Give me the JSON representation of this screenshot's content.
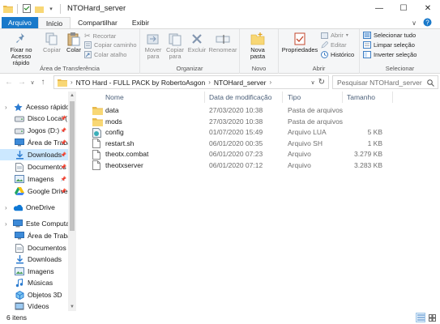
{
  "window": {
    "title": "NTOHard_server",
    "controls": {
      "minimize": "—",
      "maximize": "☐",
      "close": "✕"
    }
  },
  "ribbon_tabs": [
    {
      "label": "Arquivo"
    },
    {
      "label": "Início"
    },
    {
      "label": "Compartilhar"
    },
    {
      "label": "Exibir"
    }
  ],
  "ribbon": {
    "clipboard": {
      "pin": "Fixar no Acesso rápido",
      "copy": "Copiar",
      "paste": "Colar",
      "cut": "Recortar",
      "copy_path": "Copiar caminho",
      "paste_shortcut": "Colar atalho",
      "label": "Área de Transferência"
    },
    "organize": {
      "move_to": "Mover para",
      "copy_to": "Copiar para",
      "delete": "Excluir",
      "rename": "Renomear",
      "label": "Organizar"
    },
    "new": {
      "new_folder": "Nova pasta",
      "label": "Novo"
    },
    "open": {
      "properties": "Propriedades",
      "open": "Abrir",
      "edit": "Editar",
      "history": "Histórico",
      "label": "Abrir"
    },
    "select": {
      "select_all": "Selecionar tudo",
      "select_none": "Limpar seleção",
      "invert": "Inverter seleção",
      "label": "Selecionar"
    }
  },
  "address": {
    "path": [
      "NTO Hard - FULL PACK by RobertoAsgon",
      "NTOHard_server"
    ],
    "search_placeholder": "Pesquisar NTOHard_server"
  },
  "nav_pane": [
    {
      "label": "Acesso rápido",
      "icon": "star-icon",
      "pinned": false,
      "selected": false,
      "indent": 0
    },
    {
      "label": "Disco Local (",
      "icon": "drive-icon",
      "pinned": true,
      "selected": false,
      "indent": 1
    },
    {
      "label": "Jogos (D:)",
      "icon": "drive-icon",
      "pinned": true,
      "selected": false,
      "indent": 1
    },
    {
      "label": "Área de Trabal",
      "icon": "desktop-icon",
      "pinned": true,
      "selected": false,
      "indent": 1
    },
    {
      "label": "Downloads",
      "icon": "download-icon",
      "pinned": true,
      "selected": true,
      "indent": 1
    },
    {
      "label": "Documentos",
      "icon": "document-icon",
      "pinned": true,
      "selected": false,
      "indent": 1
    },
    {
      "label": "Imagens",
      "icon": "pictures-icon",
      "pinned": true,
      "selected": false,
      "indent": 1
    },
    {
      "label": "Google Drive",
      "icon": "google-drive-icon",
      "pinned": true,
      "selected": false,
      "indent": 1
    },
    {
      "label": "OneDrive",
      "icon": "onedrive-icon",
      "pinned": false,
      "selected": false,
      "indent": 0
    },
    {
      "label": "Este Computador",
      "icon": "computer-icon",
      "pinned": false,
      "selected": false,
      "indent": 0
    },
    {
      "label": "Área de Trabalho",
      "icon": "desktop-icon",
      "pinned": false,
      "selected": false,
      "indent": 1
    },
    {
      "label": "Documentos",
      "icon": "document-icon",
      "pinned": false,
      "selected": false,
      "indent": 1
    },
    {
      "label": "Downloads",
      "icon": "download-icon",
      "pinned": false,
      "selected": false,
      "indent": 1
    },
    {
      "label": "Imagens",
      "icon": "pictures-icon",
      "pinned": false,
      "selected": false,
      "indent": 1
    },
    {
      "label": "Músicas",
      "icon": "music-icon",
      "pinned": false,
      "selected": false,
      "indent": 1
    },
    {
      "label": "Objetos 3D",
      "icon": "objects3d-icon",
      "pinned": false,
      "selected": false,
      "indent": 1
    },
    {
      "label": "Vídeos",
      "icon": "videos-icon",
      "pinned": false,
      "selected": false,
      "indent": 1
    }
  ],
  "columns": {
    "name": "Nome",
    "date": "Data de modificação",
    "type": "Tipo",
    "size": "Tamanho"
  },
  "files": [
    {
      "name": "data",
      "date": "27/03/2020 10:38",
      "type": "Pasta de arquivos",
      "size": "",
      "icon": "folder-icon"
    },
    {
      "name": "mods",
      "date": "27/03/2020 10:38",
      "type": "Pasta de arquivos",
      "size": "",
      "icon": "folder-icon"
    },
    {
      "name": "config",
      "date": "01/07/2020 15:49",
      "type": "Arquivo LUA",
      "size": "5 KB",
      "icon": "lua-file-icon"
    },
    {
      "name": "restart.sh",
      "date": "06/01/2020 00:35",
      "type": "Arquivo SH",
      "size": "1 KB",
      "icon": "file-icon"
    },
    {
      "name": "theotx.combat",
      "date": "06/01/2020 07:23",
      "type": "Arquivo",
      "size": "3.279 KB",
      "icon": "file-icon"
    },
    {
      "name": "theotxserver",
      "date": "06/01/2020 07:12",
      "type": "Arquivo",
      "size": "3.283 KB",
      "icon": "file-icon"
    }
  ],
  "status": {
    "item_count": "6 itens"
  },
  "colors": {
    "file_tab": "#1979ca",
    "selection": "#cce8ff",
    "folder": "#f8d775",
    "header_text": "#4c607a"
  }
}
